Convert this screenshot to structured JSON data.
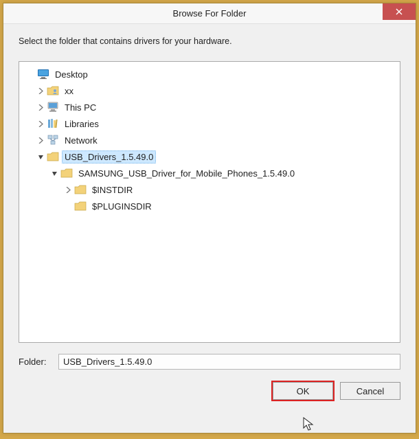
{
  "window": {
    "title": "Browse For Folder",
    "instruction": "Select the folder that contains drivers for your hardware.",
    "close_glyph": "×"
  },
  "tree": {
    "desktop": "Desktop",
    "user": "xx",
    "this_pc": "This PC",
    "libraries": "Libraries",
    "network": "Network",
    "usb_drivers": "USB_Drivers_1.5.49.0",
    "samsung": "SAMSUNG_USB_Driver_for_Mobile_Phones_1.5.49.0",
    "instdir": "$INSTDIR",
    "pluginsdir": "$PLUGINSDIR"
  },
  "footer": {
    "folder_label": "Folder:",
    "folder_value": "USB_Drivers_1.5.49.0",
    "ok_label": "OK",
    "cancel_label": "Cancel"
  },
  "colors": {
    "accent_bg": "#d4a84a",
    "select_bg": "#cde8ff",
    "close_bg": "#c75050",
    "highlight": "#d22"
  }
}
